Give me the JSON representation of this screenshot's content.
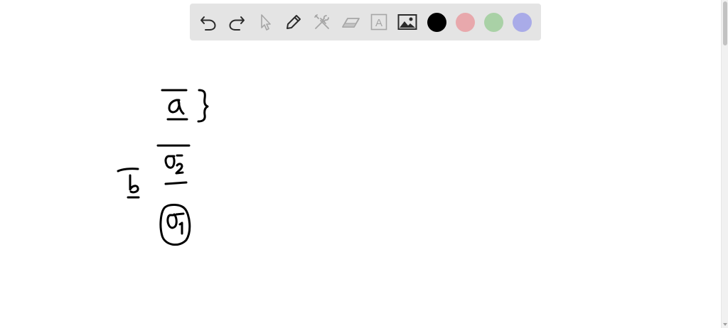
{
  "toolbar": {
    "tools": [
      {
        "name": "undo-icon",
        "state": "enabled"
      },
      {
        "name": "redo-icon",
        "state": "enabled"
      },
      {
        "name": "select-pointer-icon",
        "state": "disabled"
      },
      {
        "name": "pen-icon",
        "state": "enabled"
      },
      {
        "name": "tools-icon",
        "state": "disabled"
      },
      {
        "name": "eraser-icon",
        "state": "disabled"
      },
      {
        "name": "text-box-icon",
        "state": "disabled"
      },
      {
        "name": "image-icon",
        "state": "enabled"
      }
    ],
    "text_tool_glyph": "A",
    "colors": [
      {
        "name": "black",
        "hex": "#000000",
        "selected": true
      },
      {
        "name": "pink",
        "hex": "#e8a8ac",
        "selected": false
      },
      {
        "name": "green",
        "hex": "#a9d1a6",
        "selected": false
      },
      {
        "name": "blue",
        "hex": "#a9abe8",
        "selected": false
      }
    ],
    "background": "#e4e4e4",
    "enabled_icon_color": "#2b2b2b",
    "disabled_icon_color": "#a6a6a6"
  },
  "canvas": {
    "background": "#ffffff",
    "ink_color": "#000000"
  }
}
